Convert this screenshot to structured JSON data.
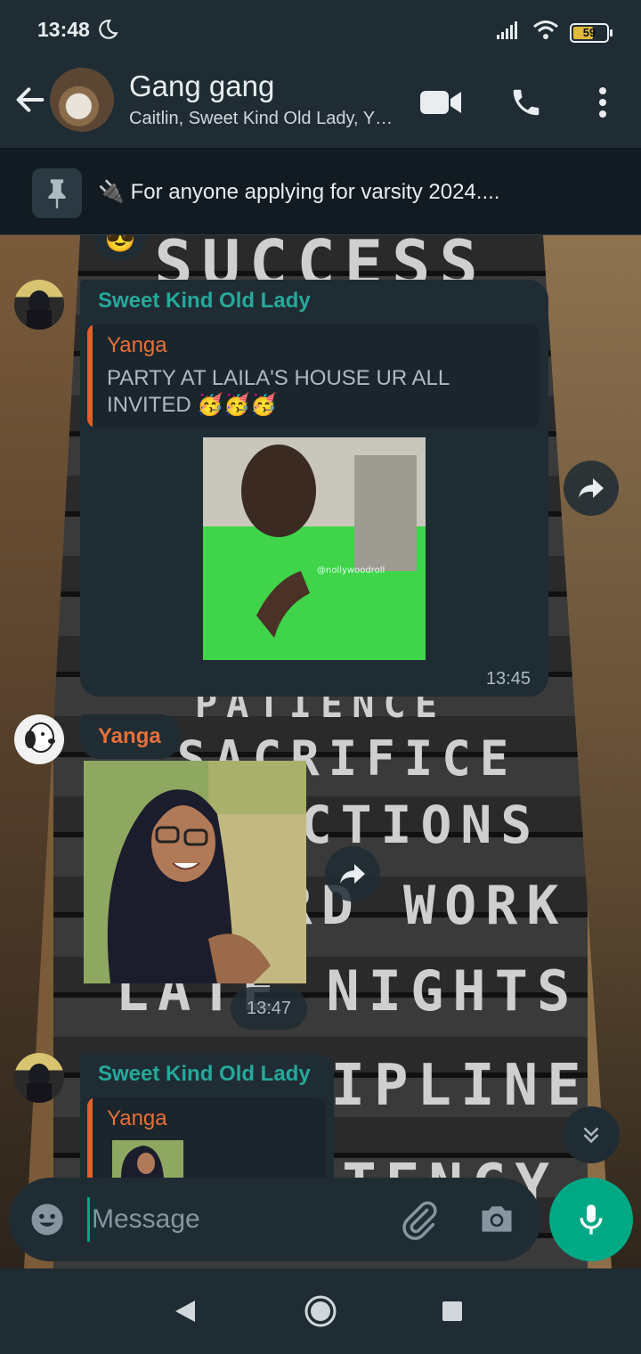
{
  "status_bar": {
    "time": "13:48",
    "battery_level": "59",
    "icons": [
      "moon-icon",
      "signal-icon",
      "wifi-icon",
      "battery-icon"
    ]
  },
  "header": {
    "group_name": "Gang gang",
    "members": "Caitlin, Sweet Kind Old Lady, Y…",
    "icons": [
      "back-arrow-icon",
      "video-call-icon",
      "phone-icon",
      "more-vert-icon"
    ]
  },
  "pinned": {
    "emoji": "🔌",
    "text": "For anyone applying for varsity 2024...."
  },
  "messages": [
    {
      "sender": "Sweet Kind Old Lady",
      "sender_color": "#25a99a",
      "quote_sender": "Yanga",
      "quote_text": "PARTY AT LAILA'S HOUSE UR ALL INVITED",
      "quote_emoji": "🥳🥳🥳",
      "media_watermark": "@nollywoodroll",
      "time": "13:45"
    },
    {
      "sender": "Yanga",
      "sender_color": "#e6703a",
      "time": "13:47"
    },
    {
      "sender": "Sweet Kind Old Lady",
      "sender_color": "#25a99a",
      "quote_sender": "Yanga"
    }
  ],
  "reaction_emoji": "😎",
  "background_words": [
    "SUCCESS",
    "PATIENCE",
    "SACRIFICE",
    "ACTIONS",
    "HARD WORK",
    "LATE NIGHTS",
    "DISCIPLINE",
    "CONSISTENCY"
  ],
  "composer": {
    "placeholder": "Message",
    "icons": [
      "emoji-icon",
      "attach-icon",
      "camera-icon",
      "mic-icon"
    ]
  },
  "accent_color": "#00a884"
}
